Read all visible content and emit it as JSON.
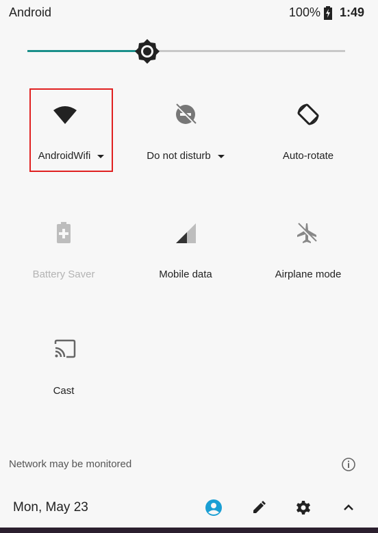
{
  "status_bar": {
    "carrier": "Android",
    "battery_percent": "100%",
    "time": "1:49"
  },
  "brightness": {
    "level_fraction": 0.375
  },
  "tiles": [
    {
      "label": "AndroidWifi",
      "icon": "wifi-icon",
      "has_dropdown": true,
      "enabled": true
    },
    {
      "label": "Do not disturb",
      "icon": "do-not-disturb-icon",
      "has_dropdown": true,
      "enabled": true
    },
    {
      "label": "Auto-rotate",
      "icon": "auto-rotate-icon",
      "has_dropdown": false,
      "enabled": true
    },
    {
      "label": "Battery Saver",
      "icon": "battery-saver-icon",
      "has_dropdown": false,
      "enabled": false
    },
    {
      "label": "Mobile data",
      "icon": "mobile-data-icon",
      "has_dropdown": false,
      "enabled": true
    },
    {
      "label": "Airplane mode",
      "icon": "airplane-mode-icon",
      "has_dropdown": false,
      "enabled": true
    },
    {
      "label": "Cast",
      "icon": "cast-icon",
      "has_dropdown": false,
      "enabled": true
    }
  ],
  "footer": {
    "note": "Network may be monitored",
    "date": "Mon, May 23"
  },
  "colors": {
    "accent": "#1a8f8a",
    "user_icon": "#1a9fd4",
    "highlight_box": "#e02020",
    "disabled": "#b3b3b3"
  }
}
